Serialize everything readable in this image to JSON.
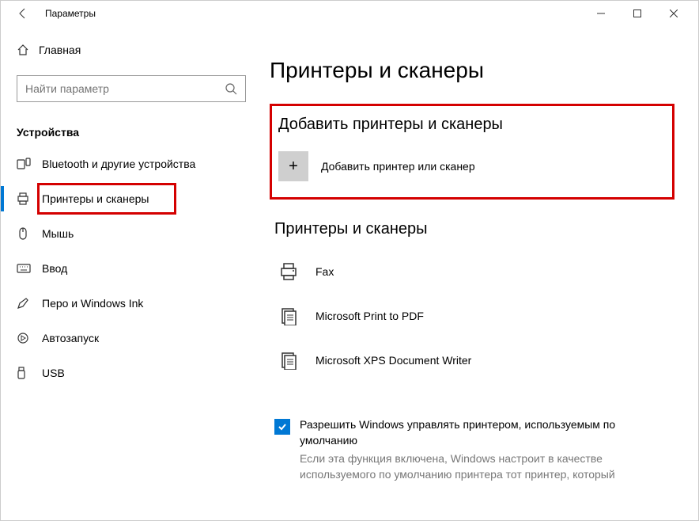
{
  "window": {
    "title": "Параметры"
  },
  "sidebar": {
    "home_label": "Главная",
    "search_placeholder": "Найти параметр",
    "section_label": "Устройства",
    "items": [
      {
        "label": "Bluetooth и другие устройства"
      },
      {
        "label": "Принтеры и сканеры"
      },
      {
        "label": "Мышь"
      },
      {
        "label": "Ввод"
      },
      {
        "label": "Перо и Windows Ink"
      },
      {
        "label": "Автозапуск"
      },
      {
        "label": "USB"
      }
    ]
  },
  "main": {
    "page_title": "Принтеры и сканеры",
    "add_section_title": "Добавить принтеры и сканеры",
    "add_label": "Добавить принтер или сканер",
    "list_section_title": "Принтеры и сканеры",
    "printers": [
      {
        "label": "Fax"
      },
      {
        "label": "Microsoft Print to PDF"
      },
      {
        "label": "Microsoft XPS Document Writer"
      }
    ],
    "checkbox_label": "Разрешить Windows управлять принтером, используемым по умолчанию",
    "help_text": "Если эта функция включена, Windows настроит в качестве используемого по умолчанию принтера тот принтер, который"
  }
}
